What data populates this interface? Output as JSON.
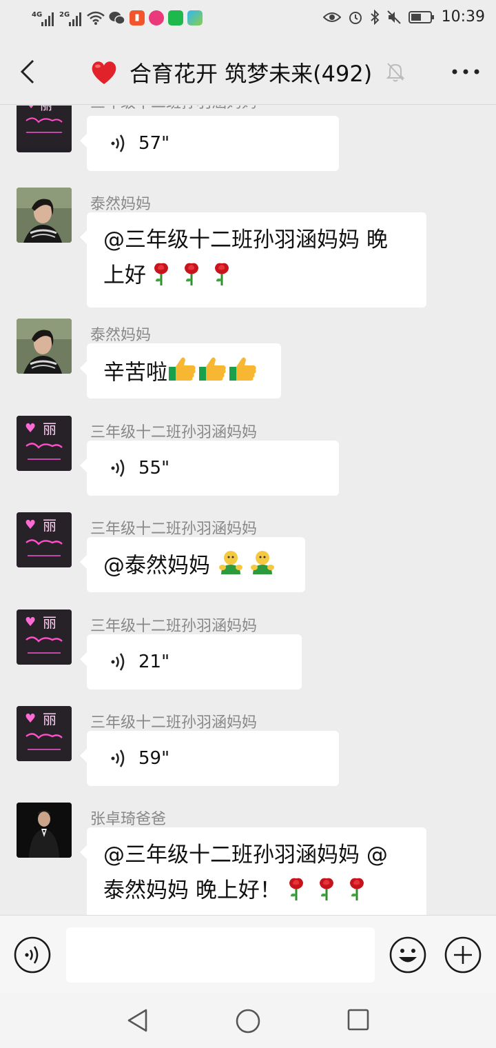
{
  "status_bar": {
    "signal_1_label": "4G",
    "signal_2_label": "2G",
    "time": "10:39",
    "icons": [
      "signal-4g-icon",
      "signal-2g-icon",
      "wifi-icon",
      "wechat-icon",
      "listen-app-icon",
      "podcast-app-icon",
      "iqiyi-app-icon",
      "video-app-icon",
      "eye-icon",
      "alarm-icon",
      "bluetooth-icon",
      "mute-icon",
      "battery-icon"
    ]
  },
  "header": {
    "title": "合育花开 筑梦未来(492)",
    "heart_color": "#e2222a"
  },
  "messages": [
    {
      "sender": "三年级十二班孙羽涵妈妈",
      "type": "voice",
      "duration": "57\""
    },
    {
      "sender": "泰然妈妈",
      "type": "text",
      "text_line1": "@三年级十二班孙羽涵妈妈  晚",
      "text_line2": "上好"
    },
    {
      "sender": "泰然妈妈",
      "type": "text",
      "text": "辛苦啦"
    },
    {
      "sender": "三年级十二班孙羽涵妈妈",
      "type": "voice",
      "duration": "55\""
    },
    {
      "sender": "三年级十二班孙羽涵妈妈",
      "type": "text",
      "text": "@泰然妈妈  "
    },
    {
      "sender": "三年级十二班孙羽涵妈妈",
      "type": "voice",
      "duration": "21\""
    },
    {
      "sender": "三年级十二班孙羽涵妈妈",
      "type": "voice",
      "duration": "59\""
    },
    {
      "sender": "张卓琦爸爸",
      "type": "text",
      "text_line1": "@三年级十二班孙羽涵妈妈 @",
      "text_line2": "泰然妈妈  晚上好！"
    }
  ],
  "avatar_text": {
    "neon_main": "丽"
  },
  "input": {
    "placeholder": ""
  },
  "colors": {
    "background": "#ededed",
    "bubble": "#ffffff",
    "sender_text": "#888888"
  }
}
